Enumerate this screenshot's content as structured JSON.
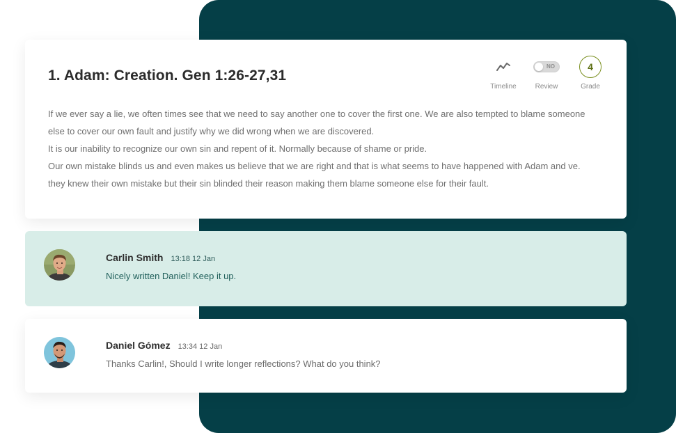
{
  "entry": {
    "title": "1. Adam: Creation. Gen 1:26-27,31",
    "controls": {
      "timeline_label": "Timeline",
      "review_label": "Review",
      "review_toggle_text": "NO",
      "grade_label": "Grade",
      "grade_value": "4"
    },
    "paragraphs": [
      "If we ever say a lie, we often times see that we need to say another one to cover the first one. We are also tempted to blame someone else to cover our own fault and justify why we did wrong when we are discovered.",
      "It is our inability to recognize our own sin and repent of it. Normally because of shame or pride.",
      "Our own mistake blinds us and even makes us believe that we are right and that is what seems to have happened with Adam and ve. they knew their own mistake but their sin blinded their reason making them blame someone else for their fault."
    ]
  },
  "comments": [
    {
      "author": "Carlin Smith",
      "time": "13:18 12 Jan",
      "text": "Nicely written Daniel! Keep it up."
    },
    {
      "author": "Daniel Gómez",
      "time": "13:34 12 Jan",
      "text": "Thanks Carlin!, Should I write longer reflections? What do you think?"
    }
  ],
  "colors": {
    "background_panel": "#053f47",
    "highlight_comment": "#d8ede8",
    "grade_accent": "#7a8f1f"
  }
}
